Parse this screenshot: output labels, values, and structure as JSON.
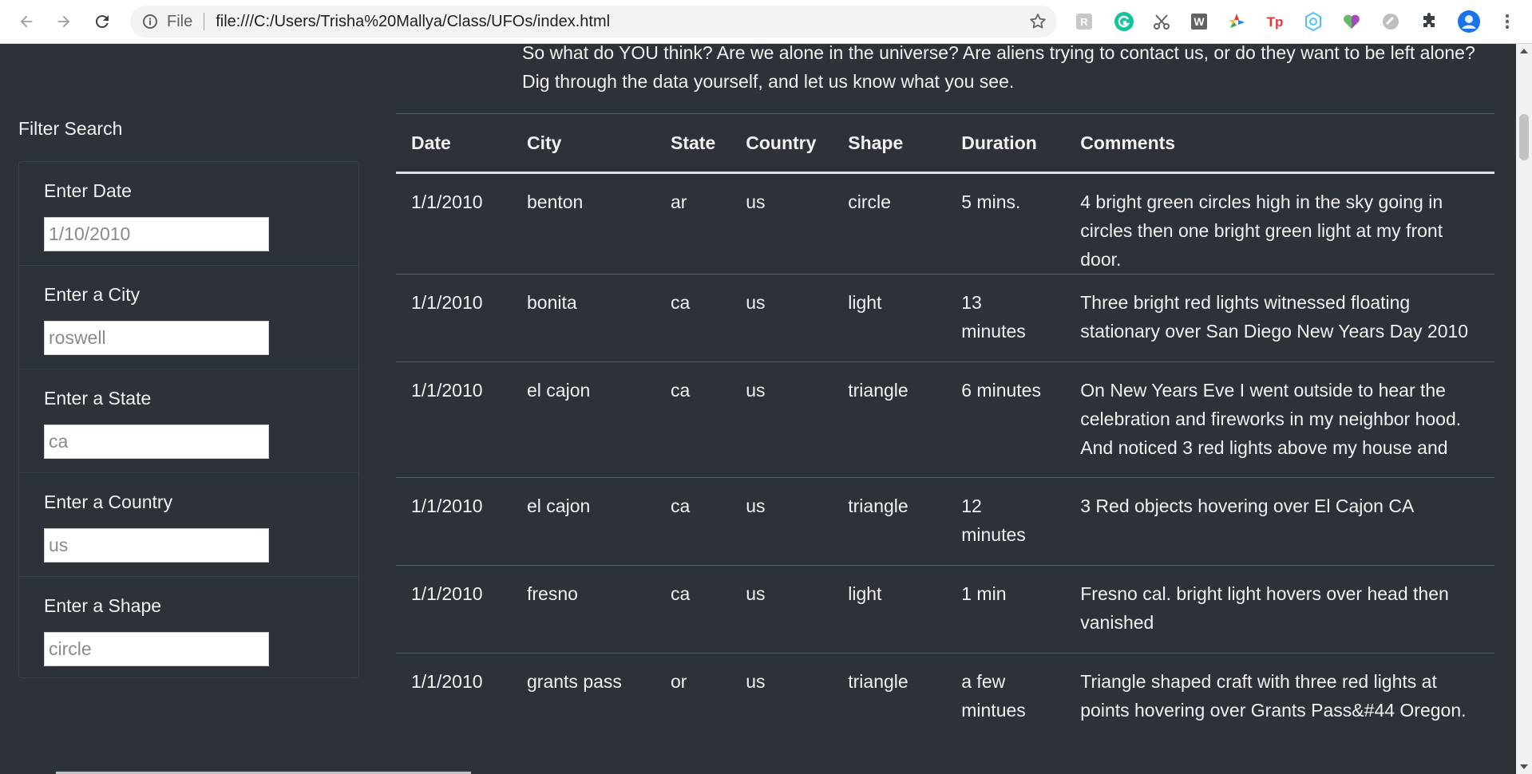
{
  "browser": {
    "file_label": "File",
    "url": "file:///C:/Users/Trisha%20Mallya/Class/UFOs/index.html"
  },
  "intro_text": "So what do YOU think? Are we alone in the universe? Are aliens trying to contact us, or do they want to be left alone? Dig through the data yourself, and let us know what you see.",
  "filters": {
    "title": "Filter Search",
    "items": [
      {
        "label": "Enter Date",
        "placeholder": "1/10/2010"
      },
      {
        "label": "Enter a City",
        "placeholder": "roswell"
      },
      {
        "label": "Enter a State",
        "placeholder": "ca"
      },
      {
        "label": "Enter a Country",
        "placeholder": "us"
      },
      {
        "label": "Enter a Shape",
        "placeholder": "circle"
      }
    ]
  },
  "table": {
    "headers": [
      "Date",
      "City",
      "State",
      "Country",
      "Shape",
      "Duration",
      "Comments"
    ],
    "rows": [
      {
        "date": "1/1/2010",
        "city": "benton",
        "state": "ar",
        "country": "us",
        "shape": "circle",
        "duration": "5 mins.",
        "comments": "4 bright green circles high in the sky going in circles then one bright green light at my front door."
      },
      {
        "date": "1/1/2010",
        "city": "bonita",
        "state": "ca",
        "country": "us",
        "shape": "light",
        "duration": "13 minutes",
        "comments": "Three bright red lights witnessed floating stationary over San Diego New Years Day 2010"
      },
      {
        "date": "1/1/2010",
        "city": "el cajon",
        "state": "ca",
        "country": "us",
        "shape": "triangle",
        "duration": "6 minutes",
        "comments": "On New Years Eve I went outside to hear the celebration and fireworks in my neighbor hood. And noticed 3 red lights above my house and"
      },
      {
        "date": "1/1/2010",
        "city": "el cajon",
        "state": "ca",
        "country": "us",
        "shape": "triangle",
        "duration": "12 minutes",
        "comments": "3 Red objects hovering over El Cajon CA"
      },
      {
        "date": "1/1/2010",
        "city": "fresno",
        "state": "ca",
        "country": "us",
        "shape": "light",
        "duration": "1 min",
        "comments": "Fresno cal. bright light hovers over head then vanished"
      },
      {
        "date": "1/1/2010",
        "city": "grants pass",
        "state": "or",
        "country": "us",
        "shape": "triangle",
        "duration": "a few mintues",
        "comments": "Triangle shaped craft with three red lights at points hovering over Grants Pass&#44 Oregon."
      }
    ]
  }
}
